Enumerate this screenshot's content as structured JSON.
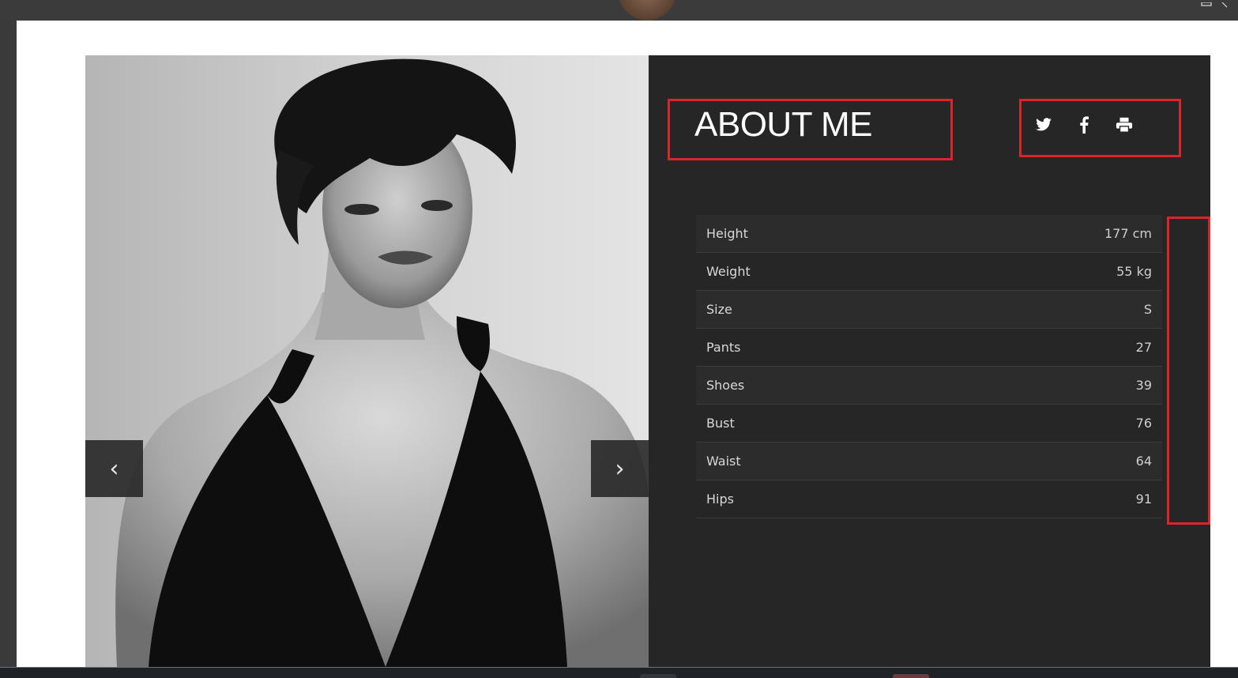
{
  "about": {
    "title": "ABOUT ME"
  },
  "social": {
    "icons": [
      "twitter-icon",
      "facebook-icon",
      "print-icon"
    ]
  },
  "stats": [
    {
      "label": "Height",
      "value": "177 cm"
    },
    {
      "label": "Weight",
      "value": "55 kg"
    },
    {
      "label": "Size",
      "value": "S"
    },
    {
      "label": "Pants",
      "value": "27"
    },
    {
      "label": "Shoes",
      "value": "39"
    },
    {
      "label": "Bust",
      "value": "76"
    },
    {
      "label": "Waist",
      "value": "64"
    },
    {
      "label": "Hips",
      "value": "91"
    }
  ],
  "slider": {
    "prev_glyph": "‹",
    "next_glyph": "›"
  },
  "colors": {
    "annotation": "#d9252a",
    "panel": "#262626"
  }
}
